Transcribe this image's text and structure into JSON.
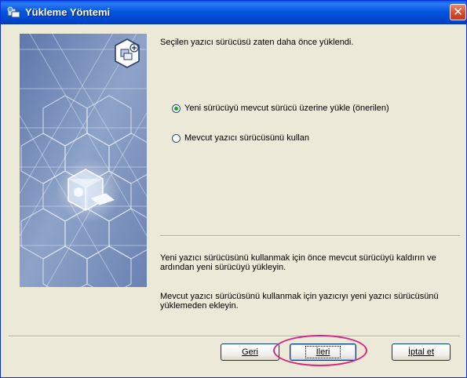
{
  "window": {
    "title": "Yükleme Yöntemi",
    "title_icon": "installer-icon",
    "close_glyph": "✕"
  },
  "main": {
    "message": "Seçilen yazıcı sürücüsü zaten daha önce yüklendi.",
    "options": [
      {
        "label": "Yeni sürücüyü mevcut sürücü üzerine yükle (önerilen)",
        "selected": true
      },
      {
        "label": "Mevcut yazıcı sürücüsünü kullan",
        "selected": false
      }
    ],
    "description_1": "Yeni yazıcı sürücüsünü kullanmak için önce mevcut sürücüyü kaldırın ve ardından yeni sürücüyü yükleyin.",
    "description_2": "Mevcut yazıcı sürücüsünü kullanmak için yazıcıyı yeni yazıcı sürücüsünü yüklemeden ekleyin."
  },
  "buttons": {
    "back": "Geri",
    "next": "İleri",
    "cancel": "İptal et"
  },
  "colors": {
    "titlebar": "#0054E3",
    "dialog_bg": "#ECE9D8",
    "highlight_ring": "#D6247E",
    "art_bg": "#7F93BC"
  }
}
